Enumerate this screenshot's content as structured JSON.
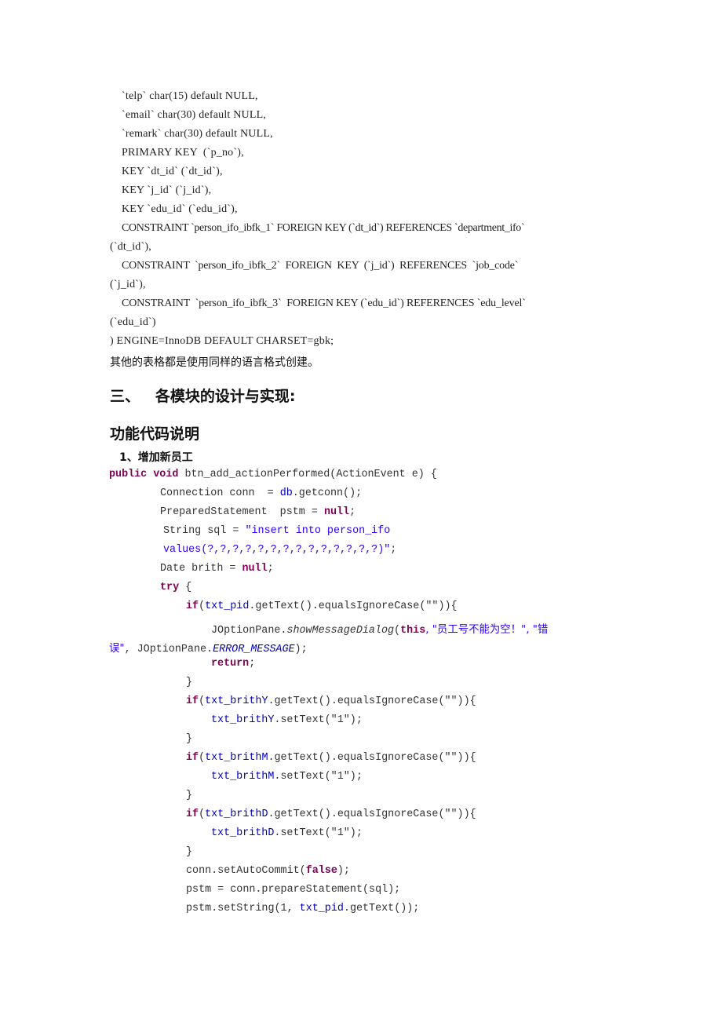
{
  "sql_lines": [
    "`telp` char(15) default NULL,",
    "`email` char(30) default NULL,",
    "`remark` char(30) default NULL,",
    "PRIMARY KEY  (`p_no`),",
    "KEY `dt_id` (`dt_id`),",
    "KEY `j_id` (`j_id`),",
    "KEY `edu_id` (`edu_id`),",
    "CONSTRAINT `person_ifo_ibfk_1` FOREIGN KEY (`dt_id`) REFERENCES `department_ifo`",
    "(`dt_id`),",
    "CONSTRAINT  `person_ifo_ibfk_2`  FOREIGN  KEY  (`j_id`)  REFERENCES  `job_code`",
    "(`j_id`),",
    "CONSTRAINT  `person_ifo_ibfk_3`  FOREIGN KEY (`edu_id`) REFERENCES `edu_level`",
    "(`edu_id`)",
    ") ENGINE=InnoDB DEFAULT CHARSET=gbk;"
  ],
  "note": "其他的表格都是使用同样的语言格式创建。",
  "section_heading": "三、   各模块的设计与实现:",
  "subheading": "功能代码说明",
  "item_heading": "1、增加新员工",
  "code": {
    "kw_public": "public",
    "kw_void": "void",
    "method_sig": " btn_add_actionPerformed(ActionEvent e) {",
    "conn_decl_a": "Connection conn  = ",
    "conn_decl_db": "db",
    "conn_decl_b": ".getconn();",
    "pstm_decl": "PreparedStatement  pstm = ",
    "kw_null": "null",
    "semicolon": ";",
    "sql_decl_a": "String sql = ",
    "sql_str_1": "\"insert into person_ifo",
    "sql_str_2": "values(?,?,?,?,?,?,?,?,?,?,?,?,?,?)\"",
    "date_decl": "Date brith = ",
    "kw_try": "try",
    "brace_open": " {",
    "kw_if": "if",
    "txt_pid": "txt_pid",
    "equals_empty": ".getText().equalsIgnoreCase(\"\")){",
    "jop": "JOptionPane.",
    "show_msg": "showMessageDialog",
    "paren_open": "(",
    "kw_this": "this",
    "msg_str_a": ", \"员工号不能为空！\", \"错",
    "msg_str_b": "误\"",
    "jop_err_a": ", JOptionPane.",
    "error_message": "ERROR_MESSAGE",
    "paren_close_semi": ");",
    "kw_return": "return",
    "brace_close": "}",
    "txt_brithY": "txt_brithY",
    "txt_brithM": "txt_brithM",
    "txt_brithD": "txt_brithD",
    "set_text_1": ".setText(\"1\");",
    "auto_commit_a": "conn.setAutoCommit(",
    "kw_false": "false",
    "prepare": "pstm = conn.prepareStatement(sql);",
    "set_string_a": "pstm.setString(1, ",
    "set_string_b": ".getText());"
  }
}
